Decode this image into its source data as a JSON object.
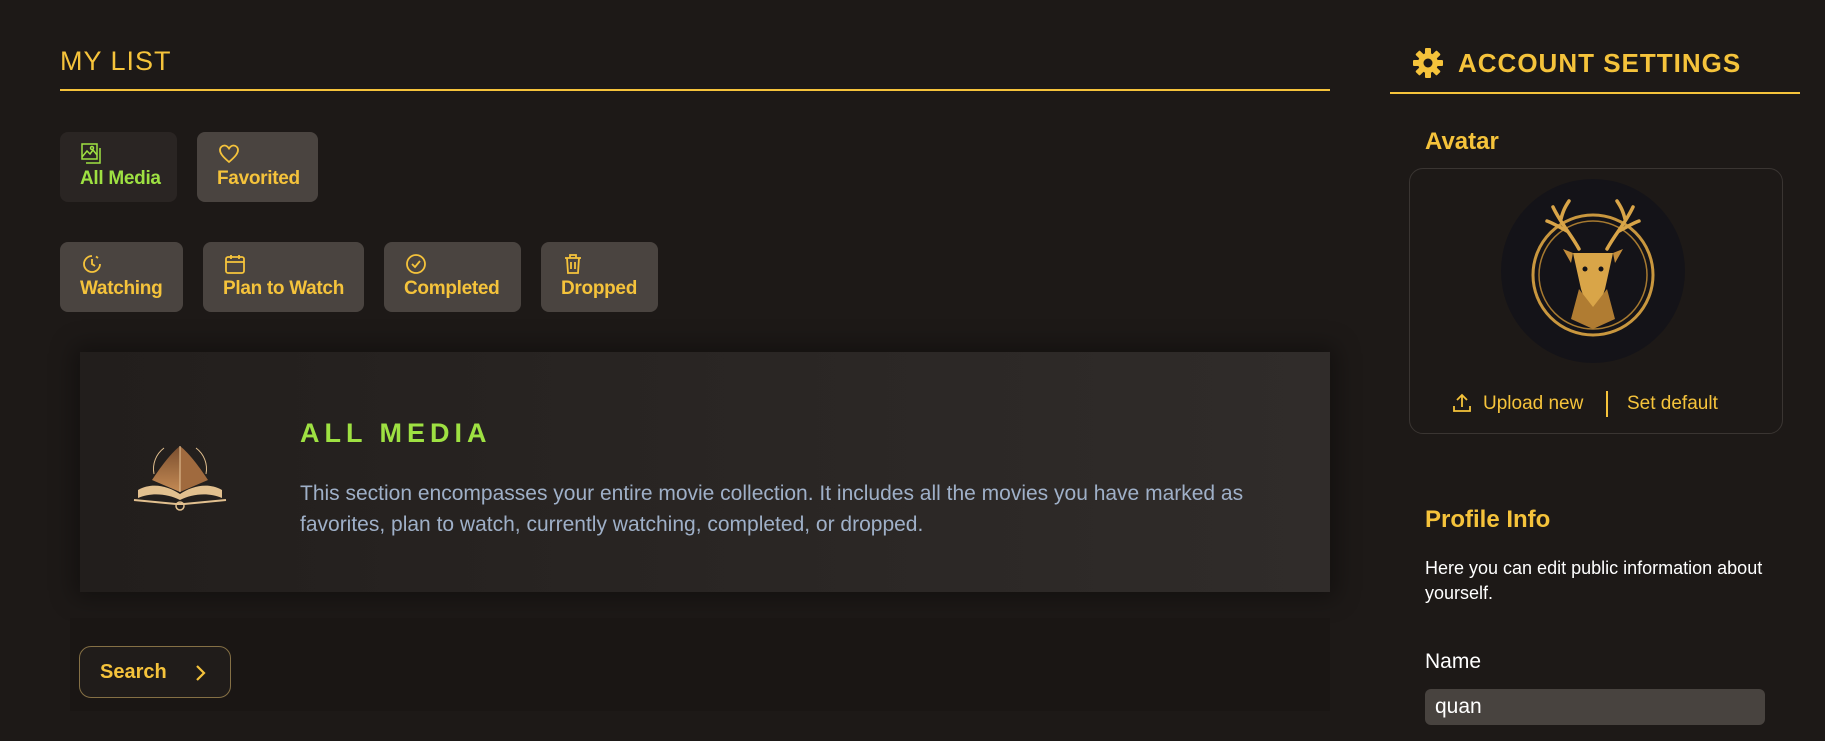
{
  "my_list": {
    "title": "MY LIST",
    "filter_tabs": [
      {
        "label": "All Media",
        "icon": "images-icon",
        "active": true
      },
      {
        "label": "Favorited",
        "icon": "heart-icon",
        "active": false
      }
    ],
    "status_tabs": [
      {
        "label": "Watching",
        "icon": "clock-icon"
      },
      {
        "label": "Plan to Watch",
        "icon": "calendar-icon"
      },
      {
        "label": "Completed",
        "icon": "check-circle-icon"
      },
      {
        "label": "Dropped",
        "icon": "trash-icon"
      }
    ],
    "info_card": {
      "title": "ALL MEDIA",
      "description": "This section encompasses your entire movie collection. It includes all the movies you have marked as favorites, plan to watch, currently watching, completed, or dropped."
    },
    "search_label": "Search"
  },
  "account": {
    "title": "ACCOUNT SETTINGS",
    "avatar_heading": "Avatar",
    "upload_label": "Upload new",
    "default_label": "Set default",
    "profile_heading": "Profile Info",
    "profile_desc": "Here you can edit public information about yourself.",
    "name_label": "Name",
    "name_value": "quan"
  },
  "colors": {
    "accent": "#f5c33b",
    "active_green": "#9ee142",
    "background": "#1d1917",
    "tab_bg": "#4a4440",
    "description_text": "#9fb0c8"
  }
}
